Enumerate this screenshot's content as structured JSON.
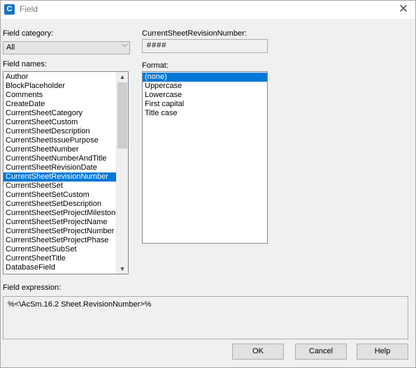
{
  "window": {
    "title": "Field",
    "app_icon_glyph": "C"
  },
  "field_category": {
    "label": "Field category:",
    "value": "All"
  },
  "field_names": {
    "label": "Field names:",
    "selected_index": 11,
    "items": [
      "Author",
      "BlockPlaceholder",
      "Comments",
      "CreateDate",
      "CurrentSheetCategory",
      "CurrentSheetCustom",
      "CurrentSheetDescription",
      "CurrentSheetIssuePurpose",
      "CurrentSheetNumber",
      "CurrentSheetNumberAndTitle",
      "CurrentSheetRevisionDate",
      "CurrentSheetRevisionNumber",
      "CurrentSheetSet",
      "CurrentSheetSetCustom",
      "CurrentSheetSetDescription",
      "CurrentSheetSetProjectMilestone",
      "CurrentSheetSetProjectName",
      "CurrentSheetSetProjectNumber",
      "CurrentSheetSetProjectPhase",
      "CurrentSheetSubSet",
      "CurrentSheetTitle",
      "DatabaseField"
    ]
  },
  "value_panel": {
    "label": "CurrentSheetRevisionNumber:",
    "value": "####"
  },
  "format": {
    "label": "Format:",
    "selected_index": 0,
    "items": [
      "(none)",
      "Uppercase",
      "Lowercase",
      "First capital",
      "Title case"
    ]
  },
  "expression": {
    "label": "Field expression:",
    "value": "%<\\AcSm.16.2 Sheet.RevisionNumber>%"
  },
  "buttons": {
    "ok": "OK",
    "cancel": "Cancel",
    "help": "Help"
  },
  "colors": {
    "selection": "#0078d7",
    "app_icon": "#1a73c8"
  },
  "icons": {
    "close": "close-icon",
    "dropdown": "chevron-down-icon",
    "scroll_up": "scroll-up-arrow-icon",
    "scroll_down": "scroll-down-arrow-icon"
  }
}
